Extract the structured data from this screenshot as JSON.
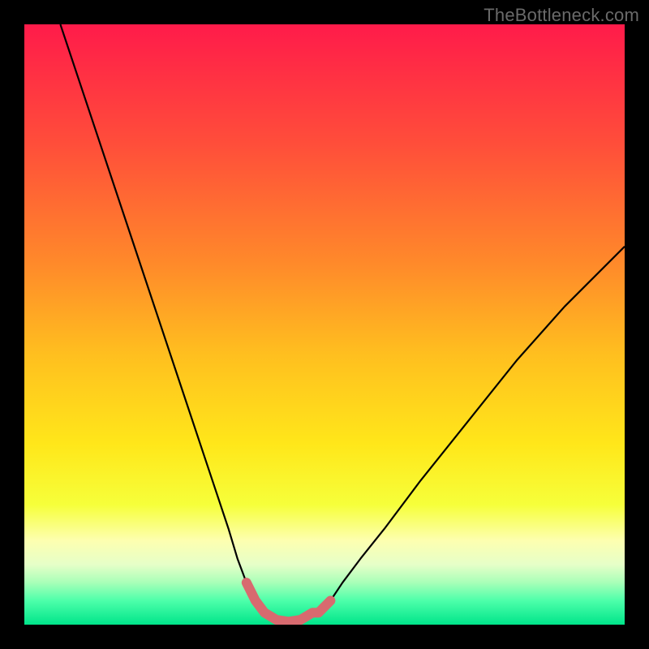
{
  "watermark": "TheBottleneck.com",
  "chart_data": {
    "type": "line",
    "title": "",
    "xlabel": "",
    "ylabel": "",
    "xlim": [
      0,
      100
    ],
    "ylim": [
      0,
      100
    ],
    "grid": false,
    "legend": false,
    "annotations": [],
    "series": [
      {
        "name": "curve-left",
        "stroke": "#000000",
        "x": [
          6,
          10,
          14,
          18,
          22,
          26,
          30,
          32,
          34,
          35.5,
          37,
          38.5,
          40
        ],
        "y": [
          100,
          88,
          76,
          64,
          52,
          40,
          28,
          22,
          16,
          11,
          7,
          4,
          2
        ]
      },
      {
        "name": "curve-right",
        "stroke": "#000000",
        "x": [
          49,
          51,
          53,
          56,
          60,
          66,
          74,
          82,
          90,
          100
        ],
        "y": [
          2,
          4,
          7,
          11,
          16,
          24,
          34,
          44,
          53,
          63
        ]
      },
      {
        "name": "highlight-trough",
        "stroke": "#d86a6f",
        "stroke_width": 12,
        "linecap": "round",
        "x": [
          37,
          38.5,
          40,
          42,
          44,
          46,
          48,
          49,
          51
        ],
        "y": [
          7,
          4,
          2,
          0.8,
          0.5,
          0.8,
          2,
          2,
          4
        ]
      }
    ],
    "background_gradient": {
      "type": "vertical",
      "stops": [
        {
          "offset": 0.0,
          "color": "#ff1b4a"
        },
        {
          "offset": 0.2,
          "color": "#ff4e3a"
        },
        {
          "offset": 0.4,
          "color": "#ff8a2a"
        },
        {
          "offset": 0.55,
          "color": "#ffbf1f"
        },
        {
          "offset": 0.7,
          "color": "#ffe71a"
        },
        {
          "offset": 0.8,
          "color": "#f6ff3a"
        },
        {
          "offset": 0.86,
          "color": "#fdffb0"
        },
        {
          "offset": 0.9,
          "color": "#e6ffc8"
        },
        {
          "offset": 0.93,
          "color": "#a8ffb8"
        },
        {
          "offset": 0.96,
          "color": "#4dffaa"
        },
        {
          "offset": 1.0,
          "color": "#00e58a"
        }
      ]
    }
  }
}
